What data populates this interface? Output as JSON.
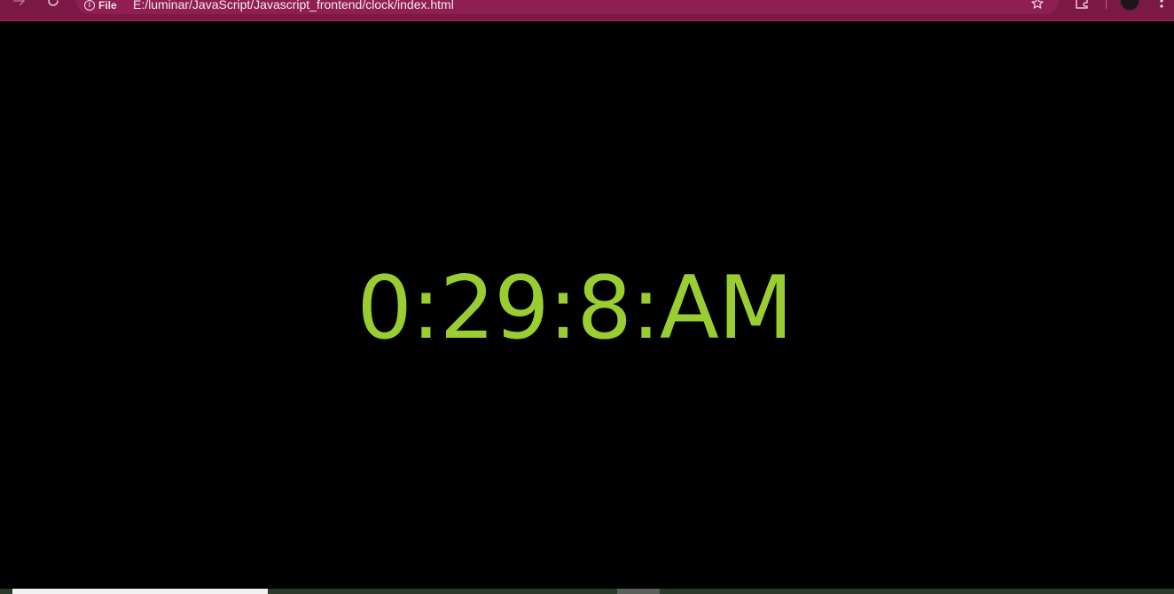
{
  "browser": {
    "site_label": "File",
    "url": "E:/luminar/JavaScript/Javascript_frontend/clock/index.html"
  },
  "clock": {
    "time_text": "0:29:8:AM"
  },
  "colors": {
    "clock_text": "#9acd32",
    "page_background": "#000000",
    "browser_bar": "#7b1846"
  },
  "icons": {
    "forward": "forward-arrow-icon",
    "reload": "reload-icon",
    "site_info": "info-icon",
    "bookmark": "star-icon",
    "extensions": "extensions-icon",
    "profile": "avatar",
    "menu": "kebab-menu-icon"
  }
}
